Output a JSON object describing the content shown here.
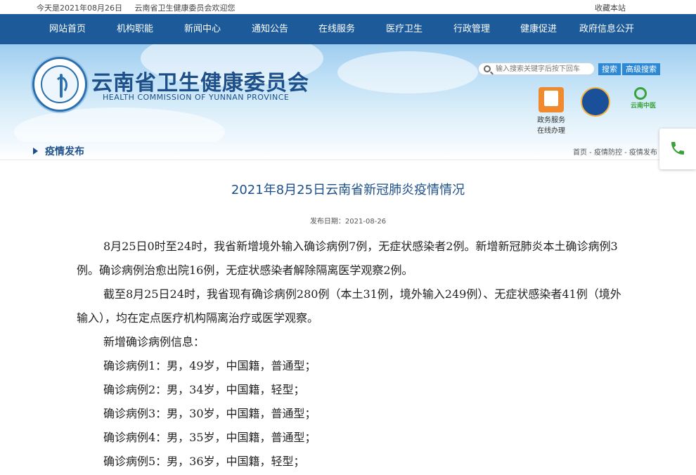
{
  "topbar": {
    "date_text": "今天是2021年08月26日",
    "welcome_text": "云南省卫生健康委员会欢迎您",
    "bookmark_label": "收藏本站"
  },
  "nav": {
    "items": [
      "网站首页",
      "机构职能",
      "新闻中心",
      "通知公告",
      "在线服务",
      "医疗卫生",
      "行政管理",
      "健康促进",
      "政府信息公开"
    ]
  },
  "header": {
    "org_name_cn": "云南省卫生健康委员会",
    "org_name_en": "HEALTH COMMISSION OF YUNNAN PROVINCE",
    "search_placeholder": "输入搜索关键字后按下回车",
    "search_button": "搜索",
    "advanced_search_button": "高级搜索",
    "service_gov_label_line1": "政务服务",
    "service_gov_label_line2": "在线办理",
    "service_yn_text": "云南中医"
  },
  "breadcrumb": {
    "section": "疫情发布",
    "path": "首页 - 疫情防控 - 疫情发布"
  },
  "article": {
    "title": "2021年8月25日云南省新冠肺炎疫情情况",
    "publish_date": "发布日期：2021-08-26",
    "paragraphs": [
      "8月25日0时至24时，我省新增境外输入确诊病例7例，无症状感染者2例。新增新冠肺炎本土确诊病例3例。确诊病例治愈出院16例，无症状感染者解除隔离医学观察2例。",
      "截至8月25日24时，我省现有确诊病例280例（本土31例，境外输入249例）、无症状感染者41例（境外输入），均在定点医疗机构隔离治疗或医学观察。",
      "新增确诊病例信息：",
      "确诊病例1：男，49岁，中国籍，普通型；",
      "确诊病例2：男，34岁，中国籍，轻型；",
      "确诊病例3：男，30岁，中国籍，普通型；",
      "确诊病例4：男，35岁，中国籍，普通型；",
      "确诊病例5：男，36岁，中国籍，轻型；"
    ]
  },
  "colors": {
    "nav_bg": "#1c5a9a",
    "title_blue": "#1d4f8a",
    "button_blue": "#2d89d6",
    "phone_green": "#3aa23a"
  }
}
